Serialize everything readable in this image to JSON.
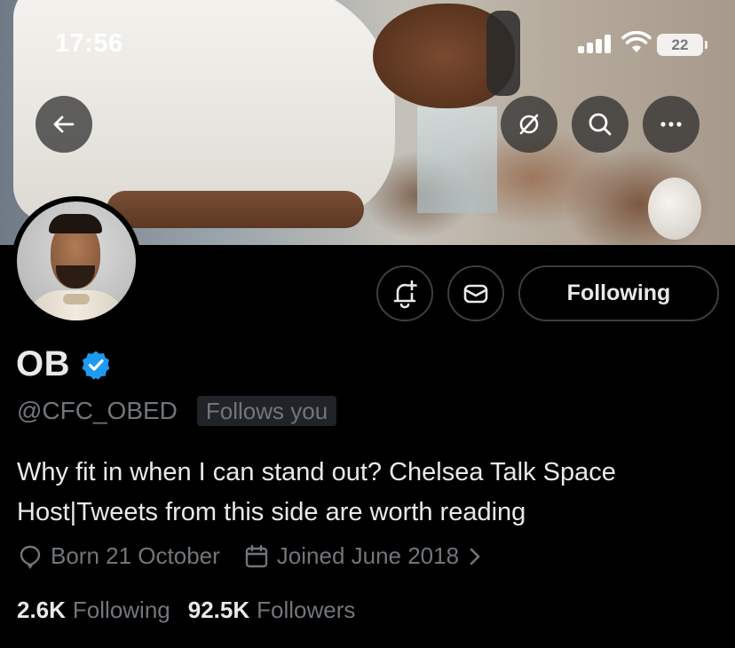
{
  "status_bar": {
    "time": "17:56",
    "battery": "22"
  },
  "banner": {
    "icons": [
      "back-arrow-icon",
      "grok-icon",
      "search-icon",
      "more-icon"
    ]
  },
  "profile": {
    "display_name": "OB",
    "handle": "@CFC_OBED",
    "follows_you": "Follows you",
    "bio": "Why fit in when I can stand out? Chelsea Talk Space Host|Tweets from this side are worth reading",
    "birthday": "Born 21 October",
    "joined": "Joined June 2018",
    "following_count": "2.6K",
    "following_label": "Following",
    "followers_count": "92.5K",
    "followers_label": "Followers"
  },
  "actions": {
    "following_button": "Following"
  },
  "colors": {
    "background": "#000000",
    "text_primary": "#e7e9ea",
    "text_secondary": "#71767b",
    "verified_blue": "#1d9bf0",
    "border": "#3a3f44"
  }
}
